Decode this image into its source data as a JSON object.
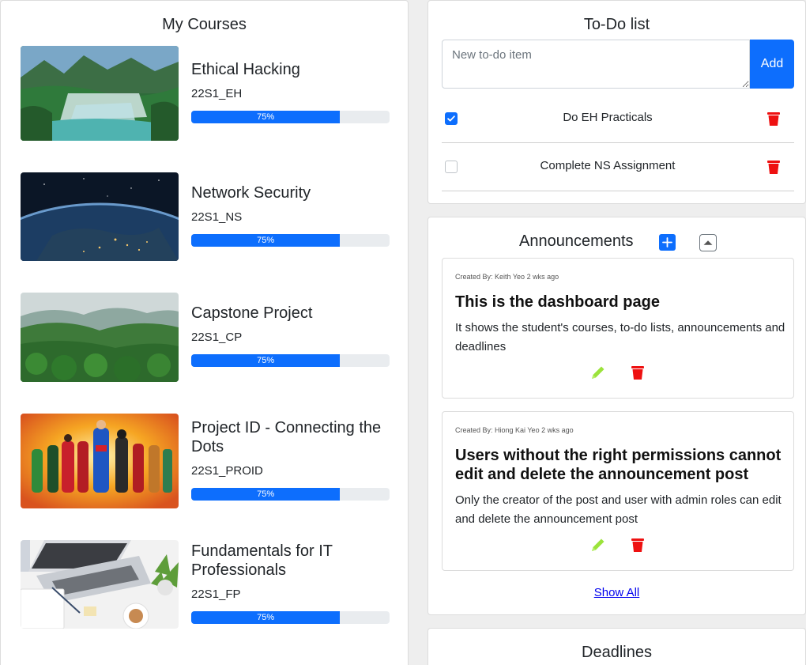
{
  "courses": {
    "title": "My Courses",
    "items": [
      {
        "name": "Ethical Hacking",
        "code": "22S1_EH",
        "progress_label": "75%",
        "progress": 0.75,
        "thumb": "waterfall"
      },
      {
        "name": "Network Security",
        "code": "22S1_NS",
        "progress_label": "75%",
        "progress": 0.75,
        "thumb": "earth-from-space"
      },
      {
        "name": "Capstone Project",
        "code": "22S1_CP",
        "progress_label": "75%",
        "progress": 0.75,
        "thumb": "forest-valley"
      },
      {
        "name": "Project ID - Connecting the Dots",
        "code": "22S1_PROID",
        "progress_label": "75%",
        "progress": 0.75,
        "thumb": "superheroes"
      },
      {
        "name": "Fundamentals for IT Professionals",
        "code": "22S1_FP",
        "progress_label": "75%",
        "progress": 0.75,
        "thumb": "laptop-desk"
      }
    ]
  },
  "todo": {
    "title": "To-Do list",
    "input_placeholder": "New to-do item",
    "add_label": "Add",
    "items": [
      {
        "text": "Do EH Practicals",
        "done": true
      },
      {
        "text": "Complete NS Assignment",
        "done": false
      }
    ]
  },
  "announcements": {
    "title": "Announcements",
    "posts": [
      {
        "meta": "Created By: Keith Yeo 2 wks ago",
        "title": "This is the dashboard page",
        "body": "It shows the student's courses, to-do lists, announcements and deadlines"
      },
      {
        "meta": "Created By: Hiong Kai Yeo 2 wks ago",
        "title": "Users without the right permissions cannot edit and delete the announcement post",
        "body": "Only the creator of the post and user with admin roles can edit and delete the announcement post"
      }
    ],
    "show_all": "Show All"
  },
  "deadlines": {
    "title": "Deadlines"
  },
  "colors": {
    "primary": "#0d6efd",
    "delete": "#ee1111",
    "edit": "#9be33b",
    "card_border": "#dcdcdc",
    "background": "#eeeeee"
  }
}
